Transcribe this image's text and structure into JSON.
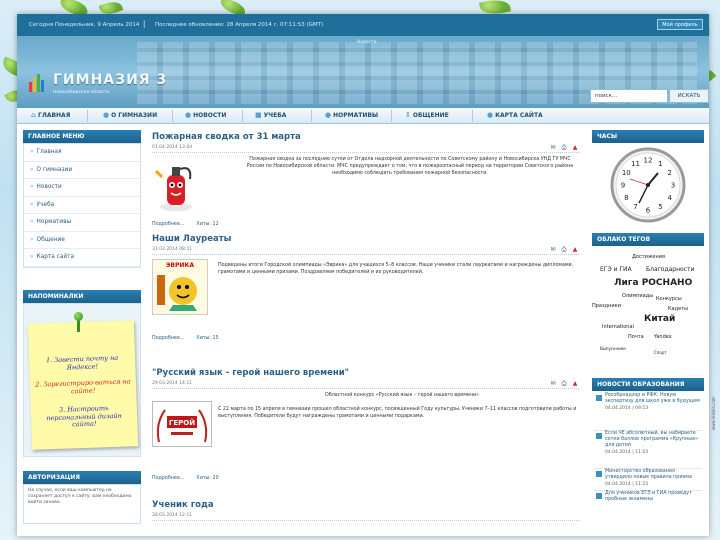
{
  "topbar": {
    "date": "Сегодня Понедельник, 9 Апрель 2014",
    "separator": "|",
    "updated": "Последнее обновление: 28 Апреля 2014 г. 07:11:53 (GMT)",
    "button_label": "Мой профиль"
  },
  "header": {
    "tagline": "Новости",
    "title": "ГИМНАЗИЯ 3",
    "subtitle": "Новосибирская область",
    "search_placeholder": "поиск...",
    "search_button": "ИСКАТЬ"
  },
  "nav": [
    {
      "label": "ГЛАВНАЯ",
      "icon": "home-icon",
      "glyph": "⌂"
    },
    {
      "label": "О ГИМНАЗИИ",
      "icon": "info-icon",
      "glyph": "●"
    },
    {
      "label": "НОВОСТИ",
      "icon": "news-icon",
      "glyph": "●"
    },
    {
      "label": "УЧЕБА",
      "icon": "book-icon",
      "glyph": "■"
    },
    {
      "label": "НОРМАТИВЫ",
      "icon": "docs-icon",
      "glyph": "●"
    },
    {
      "label": "ОБЩЕНИЕ",
      "icon": "chat-icon",
      "glyph": "↕"
    },
    {
      "label": "КАРТА САЙТА",
      "icon": "sitemap-icon",
      "glyph": "●"
    }
  ],
  "main_menu": {
    "title": "ГЛАВНОЕ МЕНЮ",
    "items": [
      "Главная",
      "О гимназии",
      "Новости",
      "Учеба",
      "Нормативы",
      "Общение",
      "Карта сайта"
    ]
  },
  "reminders": {
    "title": "НАПОМИНАЛКИ",
    "lines": [
      {
        "text": "1. Завести почту на Яндексе!",
        "color": "#2b2bbd"
      },
      {
        "text": "2. Зарегистриро-ваться на сайте!",
        "color": "#d22020"
      },
      {
        "text": "3. Настроить персональный дизайн сайта!",
        "color": "#2b2bbd"
      }
    ]
  },
  "auth": {
    "title": "АВТОРИЗАЦИЯ",
    "text": "На случае, если ваш компьютер не сохраняет доступ к сайту, вам необходимо войти заново."
  },
  "articles": [
    {
      "title": "Пожарная сводка от 31 марта",
      "meta": "01.04.2014 13:04",
      "text": "Пожарная сводка за последние сутки от Отдела надзорной деятельности по Советскому району и Новосибирска УНД ГУ МЧС России по Новосибирской области. МЧС предупреждает о том, что в пожароопасный период на территории Советского района необходимо соблюдать требования пожарной безопасности.",
      "foot_more": "Подробнее...",
      "foot_hits": "Хиты: 12"
    },
    {
      "title": "Наши Лауреаты",
      "meta": "31.03.2014 08:11",
      "image_label": "ЭВРИКА",
      "text": "Подведены итоги Городской олимпиады «Эврика» для учащихся 5–8 классов. Наши ученики стали лауреатами и награждены дипломами, грамотами и ценными призами. Поздравляем победителей и их руководителей.",
      "foot_more": "Подробнее...",
      "foot_hits": "Хиты: 15"
    },
    {
      "title": "\"Русский язык - герой нашего времени\"",
      "meta": "29.03.2014 14:11",
      "image_label": "ГЕРОЙ",
      "text_head": "Областной конкурс «Русский язык – герой нашего времени»",
      "text": "С 22 марта по 15 апреля в гимназии прошел областной конкурс, посвященный Году культуры. Ученики 7–11 классов подготовили работы и выступления. Победители будут награждены грамотами и ценными подарками.",
      "foot_more": "Подробнее...",
      "foot_hits": "Хиты: 20"
    },
    {
      "title": "Ученик года",
      "meta": "28.03.2014 12:11"
    }
  ],
  "clock": {
    "title": "ЧАСЫ",
    "numerals": [
      "12",
      "1",
      "2",
      "3",
      "4",
      "5",
      "6",
      "7",
      "8",
      "9",
      "10",
      "11"
    ]
  },
  "tags": {
    "title": "ОБЛАКО ТЕГОВ",
    "items": [
      {
        "text": "Достижения",
        "size": 5
      },
      {
        "text": "ЕГЭ и ГИА",
        "size": 6
      },
      {
        "text": "Благодарности",
        "size": 6
      },
      {
        "text": "Лига РОСНАНО",
        "size": 9
      },
      {
        "text": "Олимпиады",
        "size": 5
      },
      {
        "text": "Праздники",
        "size": 5
      },
      {
        "text": "Конкурсы",
        "size": 5
      },
      {
        "text": "Кадеты",
        "size": 5
      },
      {
        "text": "Китай",
        "size": 9
      },
      {
        "text": "International",
        "size": 5
      },
      {
        "text": "Почта",
        "size": 5
      },
      {
        "text": "Yandex",
        "size": 5
      },
      {
        "text": "Выпускники",
        "size": 4
      },
      {
        "text": "Спорт",
        "size": 4
      }
    ]
  },
  "edu_news": {
    "title": "НОВОСТИ ОБРАЗОВАНИЯ",
    "items": [
      {
        "title": "Рособрнадзор и РФК: Новую экспертизу для школ уже в будущем",
        "date": "04.04.2014 | 09:53"
      },
      {
        "title": "Если ЧЕ абсолютный, вы набираете сотни баллов программа «Крупные» для детей",
        "date": "04.04.2014 | 11:03"
      },
      {
        "title": "Министерство образования утвердило новые правила приема",
        "date": "04.04.2014 | 11:23"
      },
      {
        "title": "Для учеников ЕГЭ и ГИА проведут пробные экзамены",
        "date": ""
      }
    ]
  },
  "side_mark": "www.linkdin.com"
}
